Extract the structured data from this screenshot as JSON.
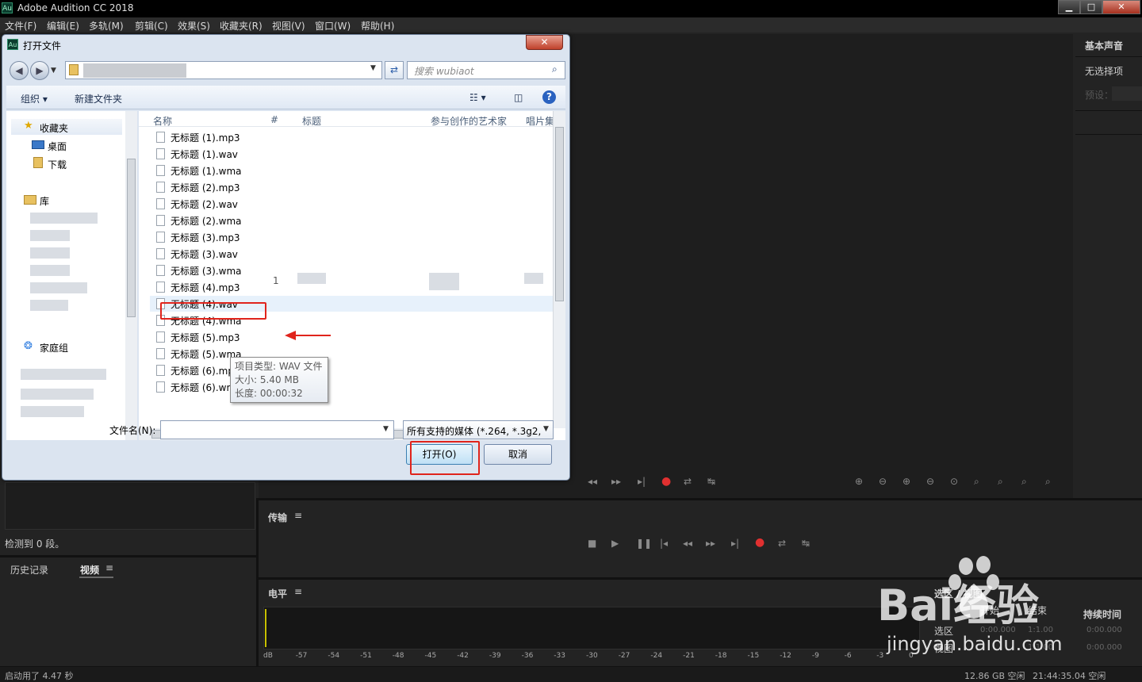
{
  "app": {
    "title": "Adobe Audition CC 2018",
    "icon": "Au"
  },
  "window_buttons": {
    "minimize": "▁",
    "maximize": "□",
    "close": "✕"
  },
  "menu": [
    "文件(F)",
    "编辑(E)",
    "多轨(M)",
    "剪辑(C)",
    "效果(S)",
    "收藏夹(R)",
    "视图(V)",
    "窗口(W)",
    "帮助(H)"
  ],
  "right_panel": {
    "title": "基本声音",
    "no_selection": "无选择项",
    "preset": "预设："
  },
  "transport": {
    "label": "传输"
  },
  "levels": {
    "label": "电平",
    "ticks": [
      "dB",
      "-57",
      "-54",
      "-51",
      "-48",
      "-45",
      "-42",
      "-39",
      "-36",
      "-33",
      "-30",
      "-27",
      "-24",
      "-21",
      "-18",
      "-15",
      "-12",
      "-9",
      "-6",
      "-3",
      "0"
    ]
  },
  "left_panel": {
    "detected": "检测到 0 段。",
    "tab_history": "历史记录",
    "tab_video": "视频"
  },
  "selection_panel": {
    "title": "选区 / 视图",
    "col_start": "开始",
    "col_end": "结束",
    "col_duration": "持续时间",
    "row_selection": "选区",
    "row_view": "视图",
    "values": [
      "0:00.000",
      "1:1.00",
      "1:1.00",
      "0:00.000",
      "0:00.000"
    ]
  },
  "status": {
    "startup": "启动用了 4.47 秒",
    "disk": "12.86 GB 空闲",
    "time": "21:44:35.04 空闲"
  },
  "dialog": {
    "title": "打开文件",
    "icon": "Au",
    "close": "✕",
    "search_placeholder": "搜索 wubiaot",
    "organize": "组织 ▾",
    "new_folder": "新建文件夹",
    "nav": {
      "favorites": "收藏夹",
      "desktop": "桌面",
      "downloads": "下载",
      "libraries": "库",
      "homegroup": "家庭组"
    },
    "columns": [
      "名称",
      "#",
      "标题",
      "参与创作的艺术家",
      "唱片集"
    ],
    "files": [
      "无标题 (1).mp3",
      "无标题 (1).wav",
      "无标题 (1).wma",
      "无标题 (2).mp3",
      "无标题 (2).wav",
      "无标题 (2).wma",
      "无标题 (3).mp3",
      "无标题 (3).wav",
      "无标题 (3).wma",
      "无标题 (4).mp3",
      "无标题 (4).wav",
      "无标题 (4).wma",
      "无标题 (5).mp3",
      "无标题 (5).wma",
      "无标题 (6).mp3",
      "无标题 (6).wma"
    ],
    "track_no": "1",
    "tooltip": {
      "type": "项目类型: WAV 文件",
      "size": "大小: 5.40 MB",
      "length": "长度: 00:00:32"
    },
    "filename_label": "文件名(N):",
    "filename_value": "",
    "filetype": "所有支持的媒体 (*.264, *.3g2,",
    "open_button": "打开(O)",
    "cancel_button": "取消"
  },
  "watermark": {
    "text": "Bai经验",
    "url": "jingyan.baidu.com"
  }
}
